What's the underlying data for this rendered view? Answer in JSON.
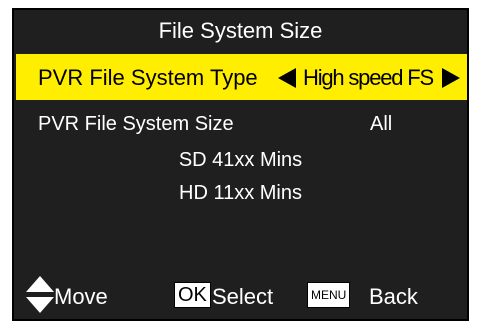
{
  "title": "File System Size",
  "selected_row": {
    "label": "PVR File System Type",
    "value": "High speed FS",
    "left_arrow_icon": "left-triangle",
    "right_arrow_icon": "right-triangle"
  },
  "size_row": {
    "label": "PVR File System Size",
    "value": "All"
  },
  "info": {
    "sd": "SD 41xx Mins",
    "hd": "HD 11xx Mins"
  },
  "footer": {
    "move_label": "Move",
    "ok_key": "OK",
    "select_label": "Select",
    "menu_key": "MENU",
    "back_label": "Back"
  },
  "colors": {
    "background": "#1f1f1f",
    "highlight": "#ffee00",
    "text": "#ffffff"
  }
}
